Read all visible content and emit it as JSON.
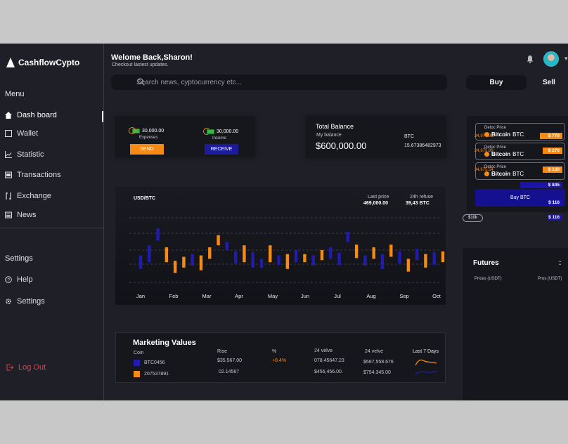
{
  "app": {
    "name": "CashflowCypto"
  },
  "sidebar": {
    "menu_label": "Menu",
    "items": [
      {
        "label": "Dash board",
        "icon": "home-icon"
      },
      {
        "label": "Wallet",
        "icon": "wallet-icon"
      },
      {
        "label": "Statistic",
        "icon": "statistic-icon"
      },
      {
        "label": "Transactions",
        "icon": "transactions-icon"
      },
      {
        "label": "Exchange",
        "icon": "exchange-icon"
      },
      {
        "label": "News",
        "icon": "news-icon"
      }
    ],
    "settings_label": "Settings",
    "bottom_items": [
      {
        "label": "Help",
        "icon": "help-icon"
      },
      {
        "label": "Settings",
        "icon": "gear-icon"
      }
    ],
    "logout": "Log Out"
  },
  "header": {
    "greeting": "Welome Back,Sharon!",
    "subtitle": "Checkout lastest updates.",
    "search_placeholder": "Search news, cyptocurrency etc...",
    "buy": "Buy",
    "sell": "Sell"
  },
  "transfer": {
    "expenses_amount": "30,000.00",
    "expenses_label": "Expenses",
    "income_amount": "30,000.00",
    "income_label": "Income",
    "send": "SEND",
    "receive": "RECEIVE"
  },
  "balance": {
    "title": "Total Balance",
    "my_balance_label": "My balance",
    "amount": "$600,000.00",
    "btc_label": "BTC",
    "btc_amount": "15.67386482973"
  },
  "chart_data": {
    "type": "candlestick",
    "title": "USD/BTC",
    "last_price_label": "Last price",
    "last_price": "469,000.00",
    "refuse_label": "24h refuse",
    "refuse_value": "39,43 BTC",
    "categories": [
      "Jan",
      "Feb",
      "Mar",
      "Apr",
      "May",
      "Jun",
      "Jul",
      "Aug",
      "Sep",
      "Oct"
    ],
    "candles": [
      {
        "open": 0.4,
        "close": 0.2,
        "color": "blue"
      },
      {
        "open": 0.55,
        "close": 0.3,
        "color": "blue"
      },
      {
        "open": 0.8,
        "close": 0.62,
        "color": "blue"
      },
      {
        "open": 0.52,
        "close": 0.3,
        "color": "orange"
      },
      {
        "open": 0.32,
        "close": 0.14,
        "color": "orange"
      },
      {
        "open": 0.38,
        "close": 0.22,
        "color": "orange"
      },
      {
        "open": 0.42,
        "close": 0.25,
        "color": "blue"
      },
      {
        "open": 0.4,
        "close": 0.18,
        "color": "orange"
      },
      {
        "open": 0.52,
        "close": 0.35,
        "color": "orange"
      },
      {
        "open": 0.7,
        "close": 0.55,
        "color": "orange"
      },
      {
        "open": 0.6,
        "close": 0.48,
        "color": "blue"
      },
      {
        "open": 0.46,
        "close": 0.28,
        "color": "blue"
      },
      {
        "open": 0.55,
        "close": 0.3,
        "color": "orange"
      },
      {
        "open": 0.45,
        "close": 0.22,
        "color": "blue"
      },
      {
        "open": 0.35,
        "close": 0.22,
        "color": "blue"
      },
      {
        "open": 0.55,
        "close": 0.3,
        "color": "orange"
      },
      {
        "open": 0.4,
        "close": 0.26,
        "color": "blue"
      },
      {
        "open": 0.42,
        "close": 0.2,
        "color": "orange"
      },
      {
        "open": 0.48,
        "close": 0.3,
        "color": "blue"
      },
      {
        "open": 0.42,
        "close": 0.3,
        "color": "orange"
      },
      {
        "open": 0.4,
        "close": 0.25,
        "color": "blue"
      },
      {
        "open": 0.48,
        "close": 0.33,
        "color": "orange"
      },
      {
        "open": 0.52,
        "close": 0.35,
        "color": "blue"
      },
      {
        "open": 0.44,
        "close": 0.26,
        "color": "blue"
      },
      {
        "open": 0.75,
        "close": 0.6,
        "color": "blue"
      },
      {
        "open": 0.56,
        "close": 0.36,
        "color": "orange"
      },
      {
        "open": 0.4,
        "close": 0.25,
        "color": "blue"
      },
      {
        "open": 0.52,
        "close": 0.35,
        "color": "orange"
      },
      {
        "open": 0.42,
        "close": 0.2,
        "color": "blue"
      },
      {
        "open": 0.56,
        "close": 0.38,
        "color": "orange"
      },
      {
        "open": 0.46,
        "close": 0.28,
        "color": "blue"
      },
      {
        "open": 0.35,
        "close": 0.16,
        "color": "orange"
      },
      {
        "open": 0.5,
        "close": 0.33,
        "color": "blue"
      },
      {
        "open": 0.42,
        "close": 0.22,
        "color": "orange"
      },
      {
        "open": 0.45,
        "close": 0.26,
        "color": "blue"
      },
      {
        "open": 0.46,
        "close": 0.3,
        "color": "orange"
      }
    ],
    "colors": {
      "orange": "#f78a14",
      "blue": "#221bb0"
    }
  },
  "detoc": [
    {
      "title": "Detoc Price",
      "coin": "Bitcoin",
      "unit": "BTC"
    },
    {
      "title": "Detoc Price",
      "coin": "Bitcoin",
      "unit": "BTC"
    },
    {
      "title": "Detoc Price",
      "coin": "Bitcoin",
      "unit": "BTC"
    }
  ],
  "buy_btc": "Buy BTC",
  "badge": "$10k",
  "futures": {
    "title": "Futures",
    "more": ":",
    "col_prices": "Prices (USDT)",
    "col_pros": "Pros (USDT)",
    "rows": [
      {
        "price": "34,970.98",
        "pro": "$ 770",
        "color": "orange",
        "fill": 0.45
      },
      {
        "price": "24,675.89",
        "pro": "$ 270",
        "color": "orange",
        "fill": 0.4
      },
      {
        "price": "34,675.54",
        "pro": "$ 130",
        "color": "orange",
        "fill": 0.4
      },
      {
        "price": "",
        "pro": "$ 845",
        "color": "blue",
        "fill": 0.85
      },
      {
        "price": "",
        "pro": "$ 116",
        "color": "blue",
        "fill": 0.28
      },
      {
        "price": "",
        "pro": "$ 116",
        "color": "blue",
        "fill": 0.28
      }
    ]
  },
  "marketing": {
    "title": "Marketing Values",
    "col_coin": "Coin",
    "col_rise": "Rise",
    "col_pct": "%",
    "col_velve1": "24  velve",
    "col_velve2": "24  velve",
    "col_last7": "Last 7 Days",
    "rows": [
      {
        "coin": "BTC0456",
        "rise": "$35,567.00",
        "pct": "+8.4%",
        "v1": "078,45647.23",
        "v2": "$567,558.676"
      },
      {
        "coin": "207537891",
        "rise": "02.14567",
        "pct": "",
        "v1": "$456,456.00.",
        "v2": "$754,345.00"
      }
    ]
  }
}
